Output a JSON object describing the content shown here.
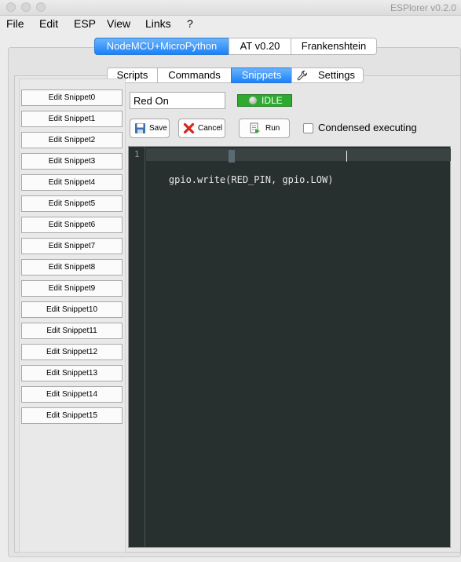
{
  "window": {
    "title": "ESPlorer v0.2.0"
  },
  "menu": [
    "File",
    "Edit",
    "ESP",
    "View",
    "Links",
    "?"
  ],
  "device_tabs": [
    "NodeMCU+MicroPython",
    "AT v0.20",
    "Frankenshtein"
  ],
  "device_tab_active": "NodeMCU+MicroPython",
  "section_tabs": [
    "Scripts",
    "Commands",
    "Snippets",
    "Settings"
  ],
  "section_tab_active": "Snippets",
  "snippets": [
    "Edit Snippet0",
    "Edit Snippet1",
    "Edit Snippet2",
    "Edit Snippet3",
    "Edit Snippet4",
    "Edit Snippet5",
    "Edit Snippet6",
    "Edit Snippet7",
    "Edit Snippet8",
    "Edit Snippet9",
    "Edit Snippet10",
    "Edit Snippet11",
    "Edit Snippet12",
    "Edit Snippet13",
    "Edit Snippet14",
    "Edit Snippet15"
  ],
  "snippet_name": "Red On",
  "status": {
    "text": "IDLE",
    "color": "#2fa92f"
  },
  "toolbar": {
    "save": "Save",
    "cancel": "Cancel",
    "run": "Run"
  },
  "condensed": {
    "label": "Condensed executing",
    "checked": false
  },
  "editor": {
    "line_number": "1",
    "code": "gpio.write(RED_PIN, gpio.LOW)"
  },
  "colors": {
    "accent": "#1a82fb",
    "editor_bg": "#27302f"
  }
}
